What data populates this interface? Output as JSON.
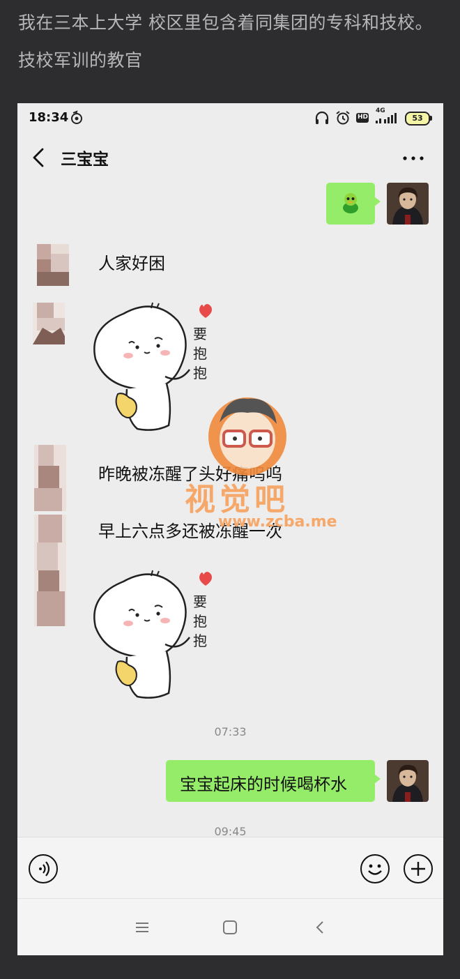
{
  "caption": "我在三本上大学 校区里包含着同集团的专科和技校。技校军训的教官",
  "status_bar": {
    "time": "18:34",
    "network": "4G",
    "hd_label": "HD",
    "battery": "53"
  },
  "chat": {
    "title": "三宝宝",
    "messages": [
      {
        "from": "me",
        "type": "emoji",
        "icon": "green-creature-icon"
      },
      {
        "from": "other",
        "type": "text",
        "text": "人家好困"
      },
      {
        "from": "other",
        "type": "sticker",
        "text": "要抱抱"
      },
      {
        "from": "other",
        "type": "text",
        "text": "昨晚被冻醒了头好痛呜呜"
      },
      {
        "from": "other",
        "type": "text",
        "text": "早上六点多还被冻醒一次"
      },
      {
        "from": "other",
        "type": "sticker",
        "text": "要抱抱"
      },
      {
        "type": "timestamp",
        "text": "07:33"
      },
      {
        "from": "me",
        "type": "text",
        "text": "宝宝起床的时候喝杯水"
      },
      {
        "type": "timestamp",
        "text": "09:45"
      }
    ]
  },
  "watermark": {
    "text": "视觉吧",
    "url": "www.zcba.me"
  },
  "colors": {
    "my_bubble": "#95ec69",
    "chat_bg": "#ededed",
    "page_bg": "#2d2d2f"
  }
}
